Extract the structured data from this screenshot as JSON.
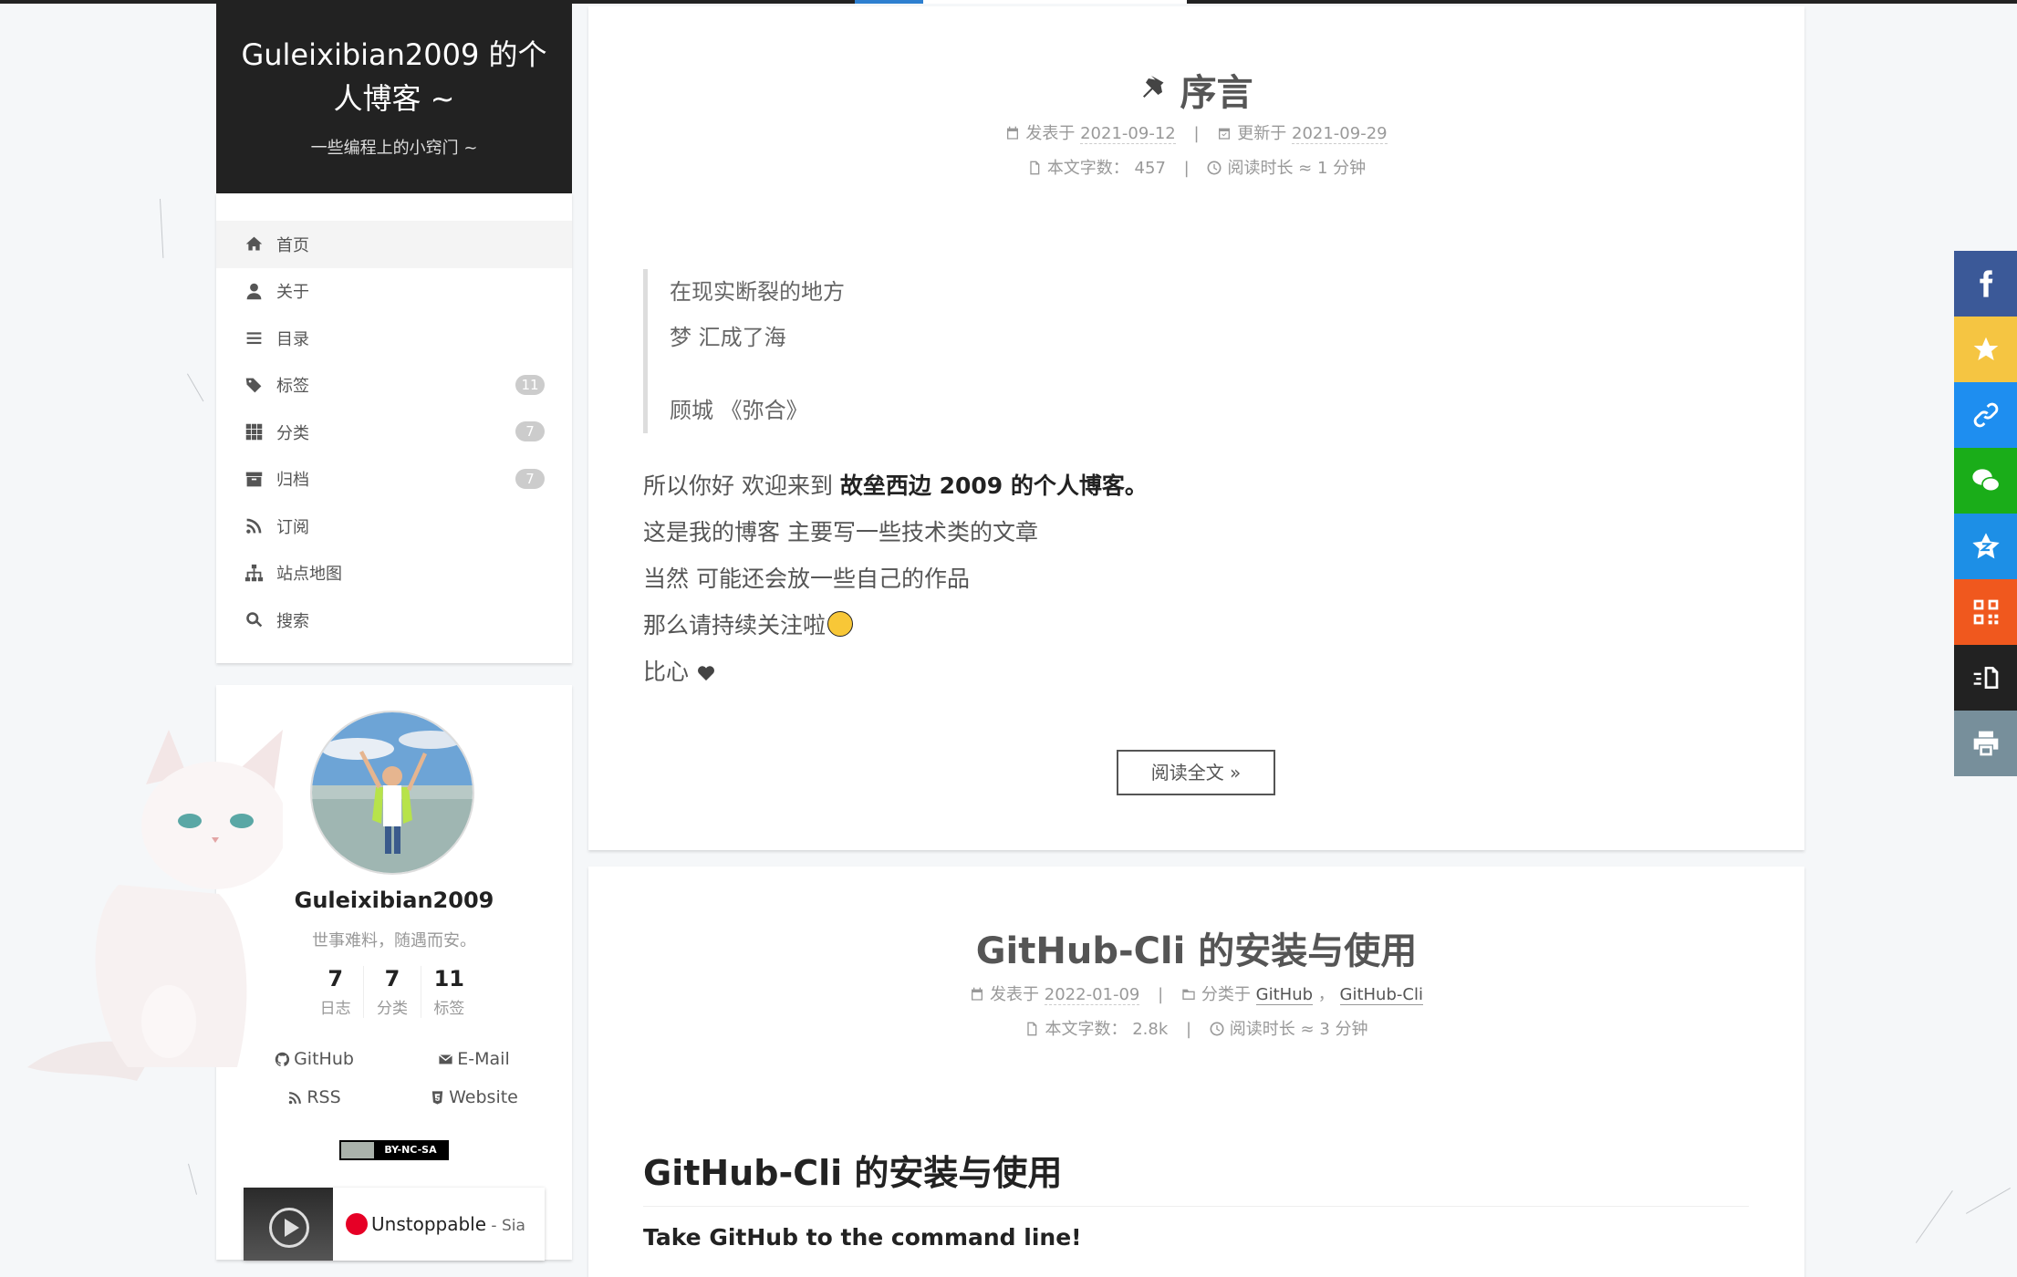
{
  "site": {
    "title": "Guleixibian2009 的个人博客 ~",
    "subtitle": "一些编程上的小窍门 ~"
  },
  "menu": [
    {
      "label": "首页",
      "icon": "home-icon",
      "badge": ""
    },
    {
      "label": "关于",
      "icon": "user-icon",
      "badge": ""
    },
    {
      "label": "目录",
      "icon": "list-icon",
      "badge": ""
    },
    {
      "label": "标签",
      "icon": "tags-icon",
      "badge": "11"
    },
    {
      "label": "分类",
      "icon": "grid-icon",
      "badge": "7"
    },
    {
      "label": "归档",
      "icon": "archive-icon",
      "badge": "7"
    },
    {
      "label": "订阅",
      "icon": "rss-icon",
      "badge": ""
    },
    {
      "label": "站点地图",
      "icon": "sitemap-icon",
      "badge": ""
    },
    {
      "label": "搜索",
      "icon": "search-icon",
      "badge": ""
    }
  ],
  "author": {
    "name": "Guleixibian2009",
    "description": "世事难料，随遇而安。",
    "stats": [
      {
        "count": "7",
        "label": "日志"
      },
      {
        "count": "7",
        "label": "分类"
      },
      {
        "count": "11",
        "label": "标签"
      }
    ],
    "links": [
      {
        "label": "GitHub",
        "icon": "github-icon"
      },
      {
        "label": "E-Mail",
        "icon": "envelope-icon"
      },
      {
        "label": "RSS",
        "icon": "rss-icon"
      },
      {
        "label": "Website",
        "icon": "html5-icon"
      }
    ],
    "license": "BY-NC-SA",
    "music": {
      "title": "Unstoppable",
      "artist": " - Sia"
    }
  },
  "posts": [
    {
      "title": "序言",
      "posted_label": "发表于",
      "posted": "2021-09-12",
      "updated_label": "更新于",
      "updated": "2021-09-29",
      "words_label": "本文字数：",
      "words": "457",
      "time_label": "阅读时长 ≈",
      "time": "1 分钟",
      "quote": [
        "在现实断裂的地方",
        "梦 汇成了海",
        "",
        "顾城 《弥合》"
      ],
      "intro_prefix": "所以你好 欢迎来到 ",
      "intro_bold": "故垒西边 2009 的个人博客。",
      "lines": [
        "这是我的博客 主要写一些技术类的文章",
        "当然 可能还会放一些自己的作品",
        "那么请持续关注啦",
        "比心"
      ],
      "read_more": "阅读全文 »"
    },
    {
      "title": "GitHub-Cli 的安装与使用",
      "posted_label": "发表于",
      "posted": "2022-01-09",
      "category_label": "分类于",
      "category1": "GitHub",
      "category2": "GitHub-Cli",
      "words_label": "本文字数：",
      "words": "2.8k",
      "time_label": "阅读时长 ≈",
      "time": "3 分钟",
      "heading": "GitHub-Cli 的安装与使用",
      "lead": "Take GitHub to the command line!"
    }
  ],
  "share": [
    {
      "icon": "facebook-icon",
      "color": "#3b5998"
    },
    {
      "icon": "star-icon",
      "color": "#f5c542"
    },
    {
      "icon": "link-icon",
      "color": "#1e8ef0"
    },
    {
      "icon": "wechat-icon",
      "color": "#1aad19"
    },
    {
      "icon": "qzone-icon",
      "color": "#1d8fe6"
    },
    {
      "icon": "qrcode-icon",
      "color": "#f0581e"
    },
    {
      "icon": "copy-icon",
      "color": "#222222"
    },
    {
      "icon": "print-icon",
      "color": "#778f9b"
    }
  ]
}
